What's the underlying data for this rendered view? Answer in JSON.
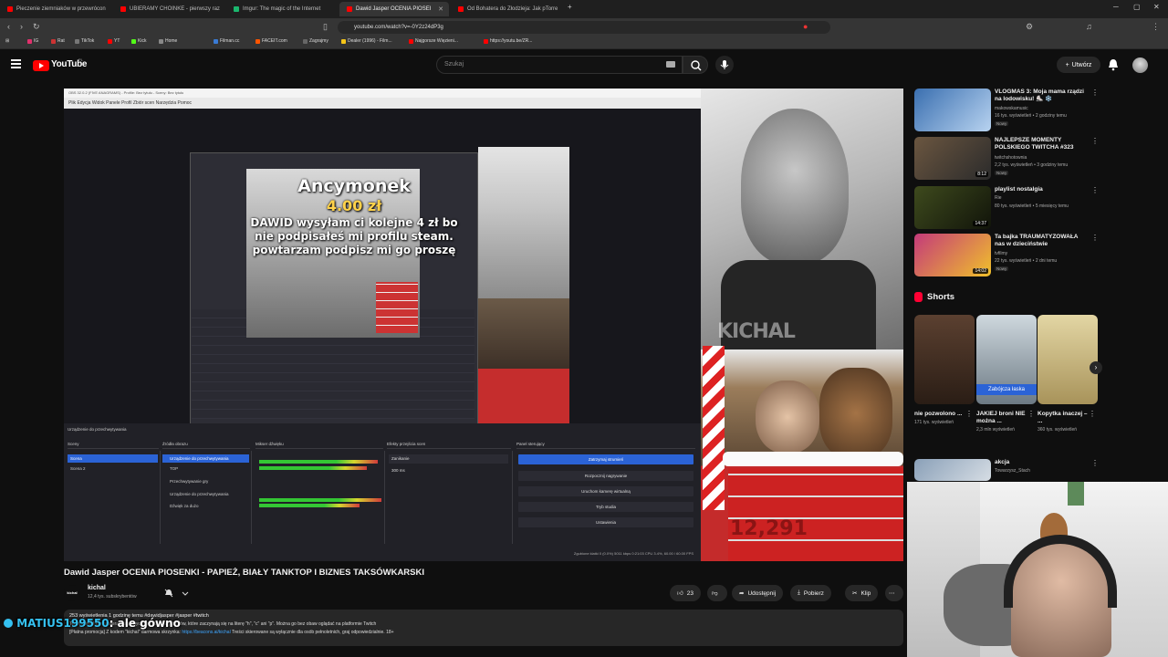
{
  "browser": {
    "tabs": [
      {
        "label": "Pieczenie ziemniaków w przewrócon",
        "icon_color": "#ff0000"
      },
      {
        "label": "UBIERAMY CHOINKE - pierwszy raz",
        "icon_color": "#ff0000"
      },
      {
        "label": "Imgur: The magic of the Internet",
        "icon_color": "#1bb76e"
      },
      {
        "label": "Dawid Jasper OCENIA PIOSEI",
        "icon_color": "#ff0000",
        "active": true
      },
      {
        "label": "Od Bohatera do Złodzieja: Jak pTorre",
        "icon_color": "#ff0000"
      }
    ],
    "url": "youtube.com/watch?v=-0Y2z24dP3g",
    "bookmarks": [
      {
        "label": "IG",
        "color": "#e1306c"
      },
      {
        "label": "Rat",
        "color": "#cc3333"
      },
      {
        "label": "TikTok",
        "color": "#222222"
      },
      {
        "label": "YT",
        "color": "#ff0000"
      },
      {
        "label": "Kick",
        "color": "#53fc18"
      },
      {
        "label": "Home",
        "color": "#888888"
      },
      {
        "label": "Filman.cc",
        "color": "#3a7bd5"
      },
      {
        "label": "FACEIT.com",
        "color": "#ff5500"
      },
      {
        "label": "Zagrajmy",
        "color": "#666666"
      },
      {
        "label": "Dealer (1996) - Film...",
        "color": "#f5c518"
      },
      {
        "label": "Najgorsze Więzieni...",
        "color": "#ff0000"
      },
      {
        "label": "https://youtu.be/ZR...",
        "color": "#ff0000"
      }
    ]
  },
  "header": {
    "logo_text": "YouTube",
    "region": "PL",
    "search_placeholder": "Szukaj",
    "create_label": "Utwórz"
  },
  "player": {
    "obs_title": "OBS 32.0.2 (FIVE ANAGRAMS) - Profile: Bez tytułu - Sceny: Bez tytułu",
    "obs_menu": "Plik   Edycja   Widok   Panele   Profil   Zbiór scen   Narzędzia   Pomoc",
    "donor_name": "Ancymonek",
    "donation_amount": "4.00 zł",
    "donation_message": "DAWID wysyłam ci kolejne 4 zł bo nie podpisałeś mi profilu steam. powtarzam podpisz mi go proszę",
    "dock_headers": [
      "Sceny",
      "Źródła obrazu",
      "Mikser dźwięku",
      "Efekty przejścia scen",
      "Panel sterujący"
    ],
    "scenes": [
      "Scena",
      "Scena 2"
    ],
    "sources": [
      "Urządzenie do przechwytywania",
      "TOP",
      "Przechwytywanie gry",
      "Urządzenie do przechwytywania",
      "Dźwięk za dużo"
    ],
    "control_buttons": [
      "Zatrzymaj strumień",
      "Rozpocznij nagrywanie",
      "Uruchom kamerę wirtualną",
      "Tryb studia",
      "Ustawienia"
    ],
    "transition": "Zanikanie",
    "duration": "300 ms",
    "status": "Zgubione klatki 0 (0.0%)   5011 kbps   0:21:03   CPU 3.4%, 60.00 / 60.00 FPS",
    "watermark": "KICHAL",
    "brick_counter": "12,291"
  },
  "video": {
    "title": "Dawid Jasper OCENIA PIOSENKI - PAPIEŻ, BIAŁY TANKTOP I BIZNES TAKSÓWKARSKI",
    "channel": "kichal",
    "channel_avatar_text": "kichal",
    "subscribers": "12,4 tys. subskrybentów",
    "likes": "23",
    "share_label": "Udostępnij",
    "download_label": "Pobierz",
    "clip_label": "Klip",
    "desc_stats": "253 wyświetlenia  1 godzinę temu  #dawidjasper #jasper #twitch",
    "desc_line1": "Ten materiał nie zawiera wulgarnych ani obraźliwych słów, które zaczynają się na literę \"h\", \"c\" ani \"p\". Można go bez obaw oglądać na platformie Twitch",
    "desc_line2_prefix": "[Płatna promocja] Z kodem \"kichal\" darmowa skrzynka: ",
    "desc_link": "https://beacons.ai/kichal",
    "desc_line2_suffix": "  Treści skierowane są wyłącznie dla osób pełnoletnich, graj odpowiedzialnie. 18+"
  },
  "chat_overlay": {
    "user": "MATIUS199550",
    "message": ": ale gówno"
  },
  "sidebar": {
    "recommendations": [
      {
        "title": "VLOGMAS 3: Moja mama rządzi na lodowisku! ⛸️ ❄️",
        "channel": "makowskamusic",
        "meta": "16 tys. wyświetleń • 2 godziny temu",
        "badge": "Nowy",
        "thumb_color": "#3a6fb0"
      },
      {
        "title": "NAJLEPSZE MOMENTY POLSKIEGO TWITCHA #323",
        "channel": "twitchshotownia",
        "meta": "2,2 tys. wyświetleń • 3 godziny temu",
        "badge": "Nowy",
        "duration": "8:12",
        "thumb_color": "#6b5640"
      },
      {
        "title": "playlist nostalgia",
        "channel": "Rie",
        "meta": "80 tys. wyświetleń • 5 miesięcy temu",
        "duration": "14:37",
        "thumb_color": "#3e4a1d"
      },
      {
        "title": "Ta bajka TRAUMATYZOWAŁA nas w dzieciństwie",
        "channel": "tvfilmy",
        "meta": "22 tys. wyświetleń • 2 dni temu",
        "badge": "Nowy",
        "duration": "14:02",
        "thumb_color": "#c43a7a"
      },
      {
        "title": "akcja",
        "channel": "Towarzysz_Stach",
        "meta": "",
        "thumb_color": "#8aa0b8"
      }
    ],
    "shorts_heading": "Shorts",
    "shorts": [
      {
        "title": "nie pozwolono ...",
        "views": "171 tys. wyświetleń",
        "thumb_color": "#5b4030"
      },
      {
        "title": "JAKIEJ broni NIE można ...",
        "views": "2,3 mln wyświetleń",
        "label": "Zabójcza łaska",
        "thumb_color": "#8fa3b0"
      },
      {
        "title": "Kopytka inaczej – ...",
        "views": "360 tys. wyświetleń",
        "thumb_color": "#c9b27a"
      }
    ]
  }
}
